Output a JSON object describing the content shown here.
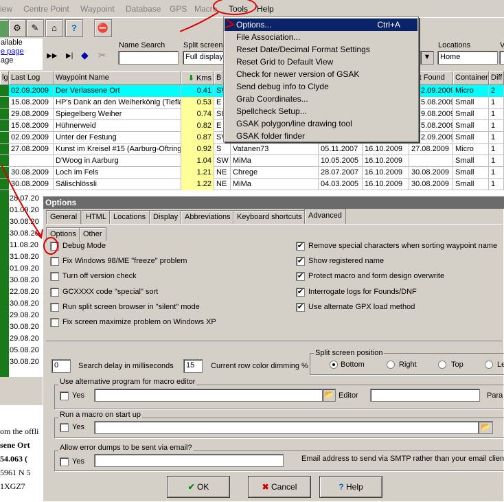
{
  "menubar": {
    "items": [
      "iew",
      "Centre Point",
      "Waypoint",
      "Database",
      "GPS",
      "Macro",
      "Tools",
      "Help"
    ]
  },
  "toolbar": {
    "filter_available": "ailable",
    "filter_page": "e page",
    "filter_age": "age",
    "name_search_label": "Name Search",
    "split_screen_label": "Split screen",
    "split_screen_value": "Full display",
    "locations_label": "Locations",
    "locations_value": "Home",
    "v_label": "V"
  },
  "tools_menu": {
    "items": [
      {
        "label": "Options...",
        "shortcut": "Ctrl+A"
      },
      {
        "label": "File Association...",
        "shortcut": ""
      },
      {
        "label": "Reset Date/Decimal Format Settings",
        "shortcut": ""
      },
      {
        "label": "Reset Grid to Default View",
        "shortcut": ""
      },
      {
        "label": "Check for newer version of GSAK",
        "shortcut": ""
      },
      {
        "label": "Send debug info to Clyde",
        "shortcut": ""
      },
      {
        "label": "Grab Coordinates...",
        "shortcut": ""
      },
      {
        "label": "Spellcheck Setup...",
        "shortcut": ""
      },
      {
        "label": "GSAK polygon/line drawing tool",
        "shortcut": ""
      },
      {
        "label": "GSAK folder finder",
        "shortcut": ""
      }
    ]
  },
  "grid": {
    "headers": [
      "lg",
      "Last Log",
      "Waypoint Name",
      "Kms",
      "B",
      "",
      "ast Found",
      "Container",
      "Diff"
    ],
    "rows": [
      {
        "lastlog": "02.09.2009",
        "name": "Der Verlassene Ort",
        "kms": "0.41",
        "b": "SV",
        "placed": "",
        "updated": "",
        "found": "2.09.2009",
        "cont": "Micro",
        "diff": "2"
      },
      {
        "lastlog": "15.08.2009",
        "name": "HP's Dank an den Weiherkönig (Tiefla",
        "kms": "0.53",
        "b": "E",
        "placed": "",
        "updated": "",
        "found": "5.08.2009",
        "cont": "Small",
        "diff": "1"
      },
      {
        "lastlog": "29.08.2009",
        "name": "Spiegelberg Weiher",
        "kms": "0.74",
        "b": "SI",
        "placed": "",
        "updated": "",
        "found": "9.08.2009",
        "cont": "Small",
        "diff": "1"
      },
      {
        "lastlog": "15.08.2009",
        "name": "Hühnerweid",
        "kms": "0.82",
        "b": "E",
        "placed": "",
        "updated": "",
        "found": "5.08.2009",
        "cont": "Small",
        "diff": "1"
      },
      {
        "lastlog": "02.09.2009",
        "name": "Unter der Festung",
        "kms": "0.87",
        "b": "SV",
        "placed": "",
        "updated": "",
        "found": "2.09.2009",
        "cont": "Small",
        "diff": "1"
      },
      {
        "lastlog": "27.08.2009",
        "name": "Kunst im Kreisel #15 (Aarburg-Oftringer",
        "kms": "0.92",
        "b": "S",
        "placed": "Vatanen73",
        "updated": "05.11.2007",
        "found": "16.10.2009",
        "cont": "Micro",
        "diff": "1",
        "f2": "27.08.2009"
      },
      {
        "lastlog": "",
        "name": "D'Woog in Aarburg",
        "kms": "1.04",
        "b": "SW",
        "placed": "MiMa",
        "updated": "10.05.2005",
        "found": "16.10.2009",
        "cont": "Small",
        "diff": "1",
        "f2": ""
      },
      {
        "lastlog": "30.08.2009",
        "name": "Loch im Fels",
        "kms": "1.21",
        "b": "NE",
        "placed": "Chrege",
        "updated": "28.07.2007",
        "found": "16.10.2009",
        "cont": "Small",
        "diff": "1",
        "f2": "30.08.2009"
      },
      {
        "lastlog": "30.08.2009",
        "name": "Sälischlössli",
        "kms": "1.22",
        "b": "NE",
        "placed": "MiMa",
        "updated": "04.03.2005",
        "found": "16.10.2009",
        "cont": "Small",
        "diff": "1",
        "f2": "30.08.2009"
      }
    ],
    "left_dates": [
      "28.07.20",
      "01.09.20",
      "30.08.20",
      "30.08.20",
      "11.08.20",
      "31.08.20",
      "01.09.20",
      "30.08.20",
      "22.08.20",
      "30.08.20",
      "29.08.20",
      "30.08.20",
      "29.08.20",
      "05.08.20",
      "30.08.20"
    ]
  },
  "bottom_text": {
    "line1": "om the offli",
    "line2": "sene Ort",
    "line3": "54.063 (",
    "line4": "5961  N 5",
    "line5": "1XGZ7"
  },
  "options": {
    "title": "Options",
    "tabs": [
      "General",
      "HTML",
      "Locations",
      "Display",
      "Abbreviations",
      "Keyboard shortcuts",
      "Advanced"
    ],
    "subtabs": [
      "Options",
      "Other"
    ],
    "left_checks": [
      {
        "label": "Debug Mode",
        "checked": false
      },
      {
        "label": "Fix Windows 98/ME \"freeze\" problem",
        "checked": false
      },
      {
        "label": "Turn off version check",
        "checked": false
      },
      {
        "label": "GCXXXX code \"special\" sort",
        "checked": false
      },
      {
        "label": "Run split screen browser in \"silent\" mode",
        "checked": false
      },
      {
        "label": "Fix screen maximize problem on Windows XP",
        "checked": false
      }
    ],
    "right_checks": [
      {
        "label": "Remove special characters when sorting waypoint name",
        "checked": true
      },
      {
        "label": "Show registered name",
        "checked": true
      },
      {
        "label": "Protect macro and form design overwrite",
        "checked": true
      },
      {
        "label": "Interrogate logs for Founds/DNF",
        "checked": true
      },
      {
        "label": "Use alternate GPX load method",
        "checked": true
      }
    ],
    "search_delay_value": "0",
    "search_delay_label": "Search delay in milliseconds",
    "dimming_value": "15",
    "dimming_label": "Current row color dimming %",
    "split_position_label": "Split screen position",
    "split_options": [
      "Bottom",
      "Right",
      "Top",
      "Le"
    ],
    "alt_editor_label": "Use alternative program for macro editor",
    "yes_label": "Yes",
    "editor_label": "Editor",
    "para_label": "Para",
    "macro_startup_label": "Run a macro on start up",
    "error_dump_label": "Allow error dumps to be sent via email?",
    "email_label": "Email address to send via SMTP rather than your email client",
    "ok_label": "OK",
    "cancel_label": "Cancel",
    "help_label": "Help"
  }
}
